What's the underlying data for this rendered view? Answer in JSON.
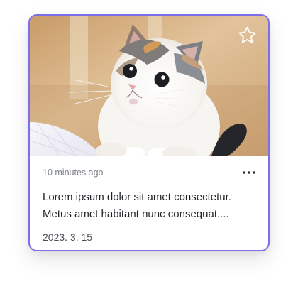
{
  "card": {
    "image_subject": "kitten",
    "favorite_icon": "star-outline-icon",
    "more_icon": "more-horizontal-icon",
    "timestamp": "10 minutes ago",
    "body": "Lorem ipsum dolor sit amet consectetur. Metus amet habitant nunc consequat....",
    "date": "2023. 3. 15"
  },
  "colors": {
    "card_border": "#7b70ea",
    "meta_text": "#7a7f88",
    "body_text": "#1f2328",
    "date_text": "#4a4f57"
  }
}
